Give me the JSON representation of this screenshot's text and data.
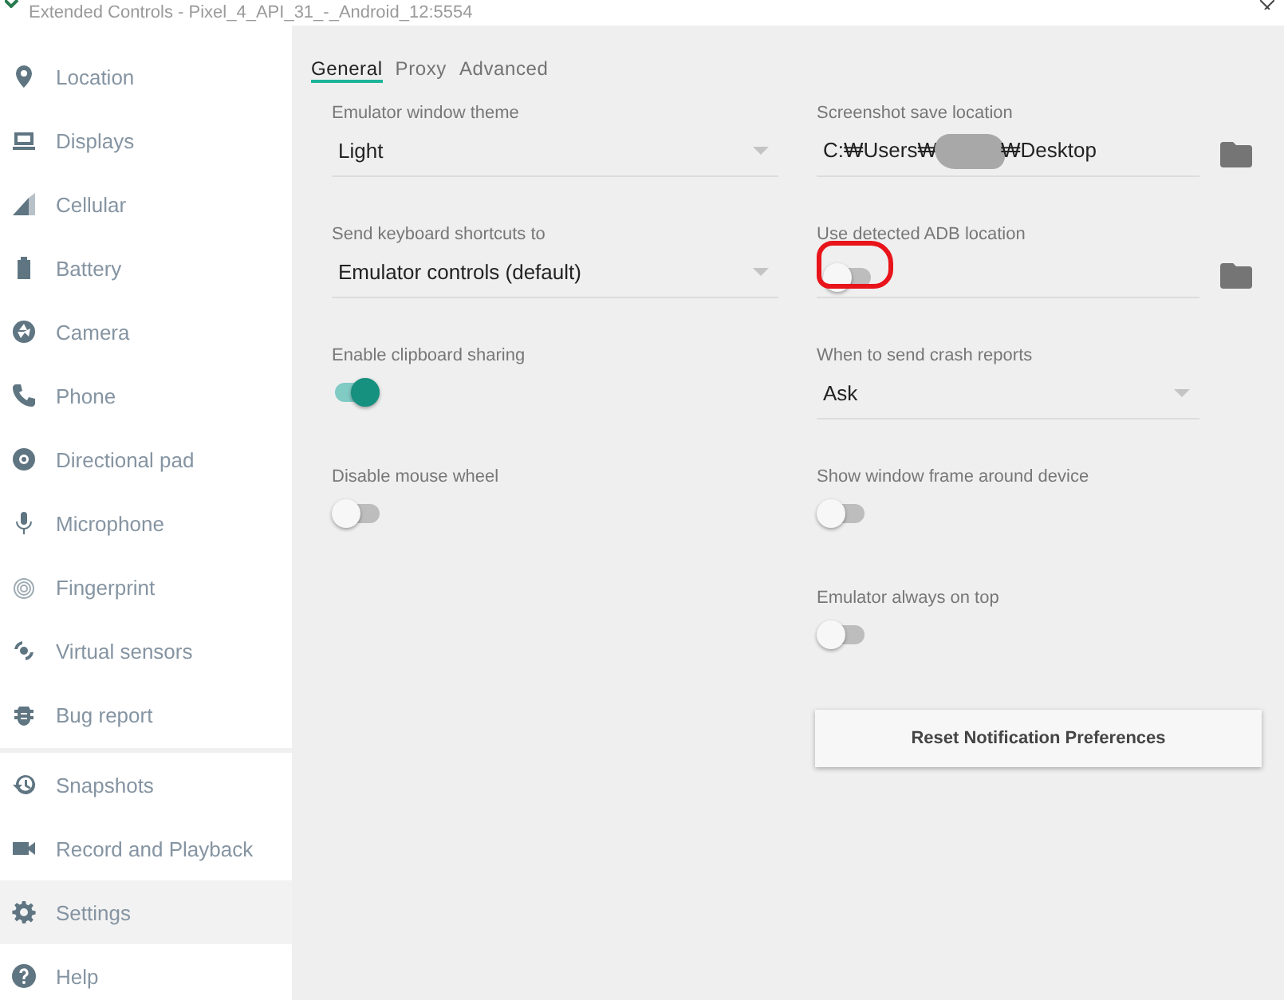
{
  "window": {
    "title": "Extended Controls - Pixel_4_API_31_-_Android_12:5554"
  },
  "sidebar": {
    "items": [
      {
        "label": "Location",
        "selected": false
      },
      {
        "label": "Displays",
        "selected": false
      },
      {
        "label": "Cellular",
        "selected": false
      },
      {
        "label": "Battery",
        "selected": false
      },
      {
        "label": "Camera",
        "selected": false
      },
      {
        "label": "Phone",
        "selected": false
      },
      {
        "label": "Directional pad",
        "selected": false
      },
      {
        "label": "Microphone",
        "selected": false
      },
      {
        "label": "Fingerprint",
        "selected": false
      },
      {
        "label": "Virtual sensors",
        "selected": false
      },
      {
        "label": "Bug report",
        "selected": false,
        "divider_after": true
      },
      {
        "label": "Snapshots",
        "selected": false
      },
      {
        "label": "Record and Playback",
        "selected": false
      },
      {
        "label": "Settings",
        "selected": true
      },
      {
        "label": "Help",
        "selected": false
      }
    ]
  },
  "tabs": [
    {
      "label": "General",
      "selected": true
    },
    {
      "label": "Proxy",
      "selected": false
    },
    {
      "label": "Advanced",
      "selected": false
    }
  ],
  "settings": {
    "left": [
      {
        "kind": "dropdown",
        "label": "Emulator window theme",
        "value": "Light"
      },
      {
        "kind": "dropdown",
        "label": "Send keyboard shortcuts to",
        "value": "Emulator controls (default)"
      },
      {
        "kind": "toggle",
        "label": "Enable clipboard sharing",
        "on": true
      },
      {
        "kind": "toggle",
        "label": "Disable mouse wheel",
        "on": false
      }
    ],
    "right": [
      {
        "kind": "path",
        "label": "Screenshot save location",
        "value_parts": [
          "C:₩Users₩",
          "₩Desktop"
        ]
      },
      {
        "kind": "toggle_path",
        "label": "Use detected ADB location",
        "on": false,
        "circled": true
      },
      {
        "kind": "dropdown",
        "label": "When to send crash reports",
        "value": "Ask"
      },
      {
        "kind": "toggle",
        "label": "Show window frame around device",
        "on": false
      },
      {
        "kind": "toggle",
        "label": "Emulator always on top",
        "on": false
      },
      {
        "kind": "button",
        "label": "Reset Notification Preferences"
      }
    ]
  }
}
